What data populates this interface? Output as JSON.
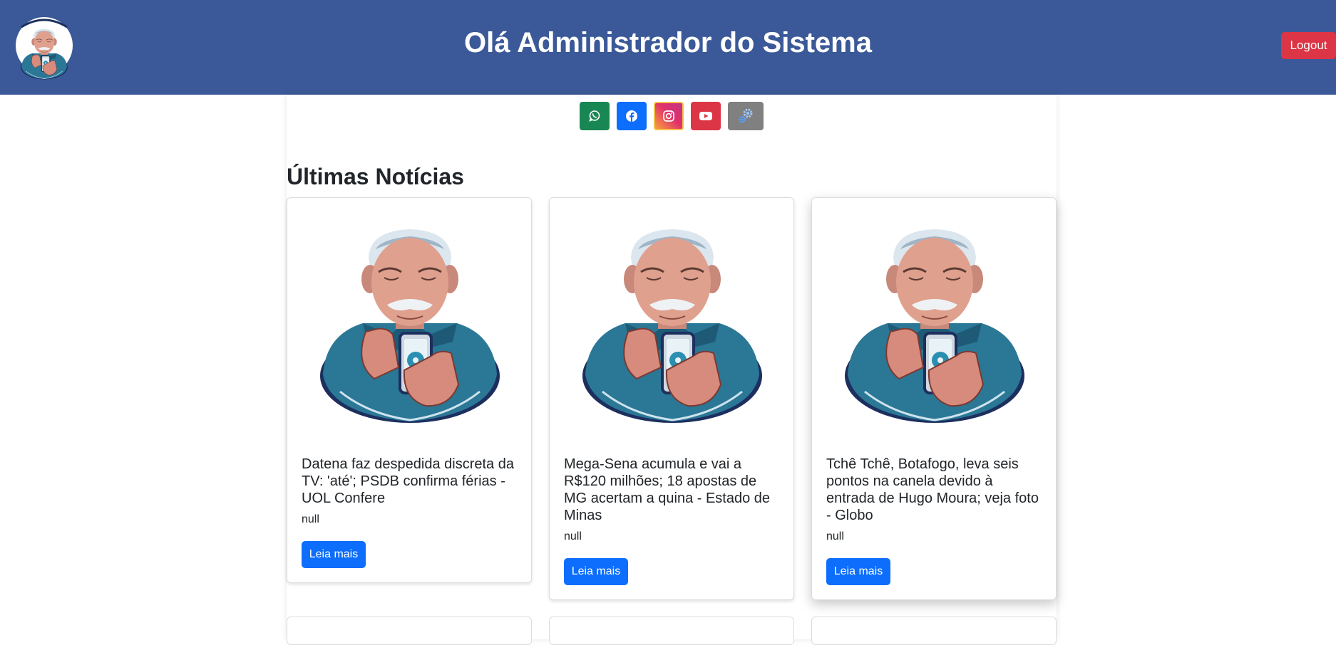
{
  "header": {
    "title": "Olá Administrador do Sistema",
    "logout_label": "Logout",
    "logo_icon": "old-man-with-phone-logo",
    "background_color": "#3b5998"
  },
  "social_links": [
    {
      "name": "whatsapp",
      "icon": "whatsapp-icon",
      "color": "#198754"
    },
    {
      "name": "facebook",
      "icon": "facebook-icon",
      "color": "#0d6efd"
    },
    {
      "name": "instagram",
      "icon": "instagram-icon",
      "color": "#e1306c"
    },
    {
      "name": "youtube",
      "icon": "youtube-icon",
      "color": "#dc3545"
    },
    {
      "name": "settings",
      "icon": "gears-icon",
      "color": "#808080"
    }
  ],
  "news": {
    "section_title": "Últimas Notícias",
    "read_more_label": "Leia mais",
    "items": [
      {
        "title": "Datena faz despedida discreta da TV: 'até'; PSDB confirma férias - UOL Confere",
        "description": "null",
        "image_icon": "old-man-with-phone-illustration"
      },
      {
        "title": "Mega-Sena acumula e vai a R$120 milhões; 18 apostas de MG acertam a quina - Estado de Minas",
        "description": "null",
        "image_icon": "old-man-with-phone-illustration"
      },
      {
        "title": "Tchê Tchê, Botafogo, leva seis pontos na canela devido à entrada de Hugo Moura; veja foto - Globo",
        "description": "null",
        "image_icon": "old-man-with-phone-illustration"
      }
    ]
  }
}
